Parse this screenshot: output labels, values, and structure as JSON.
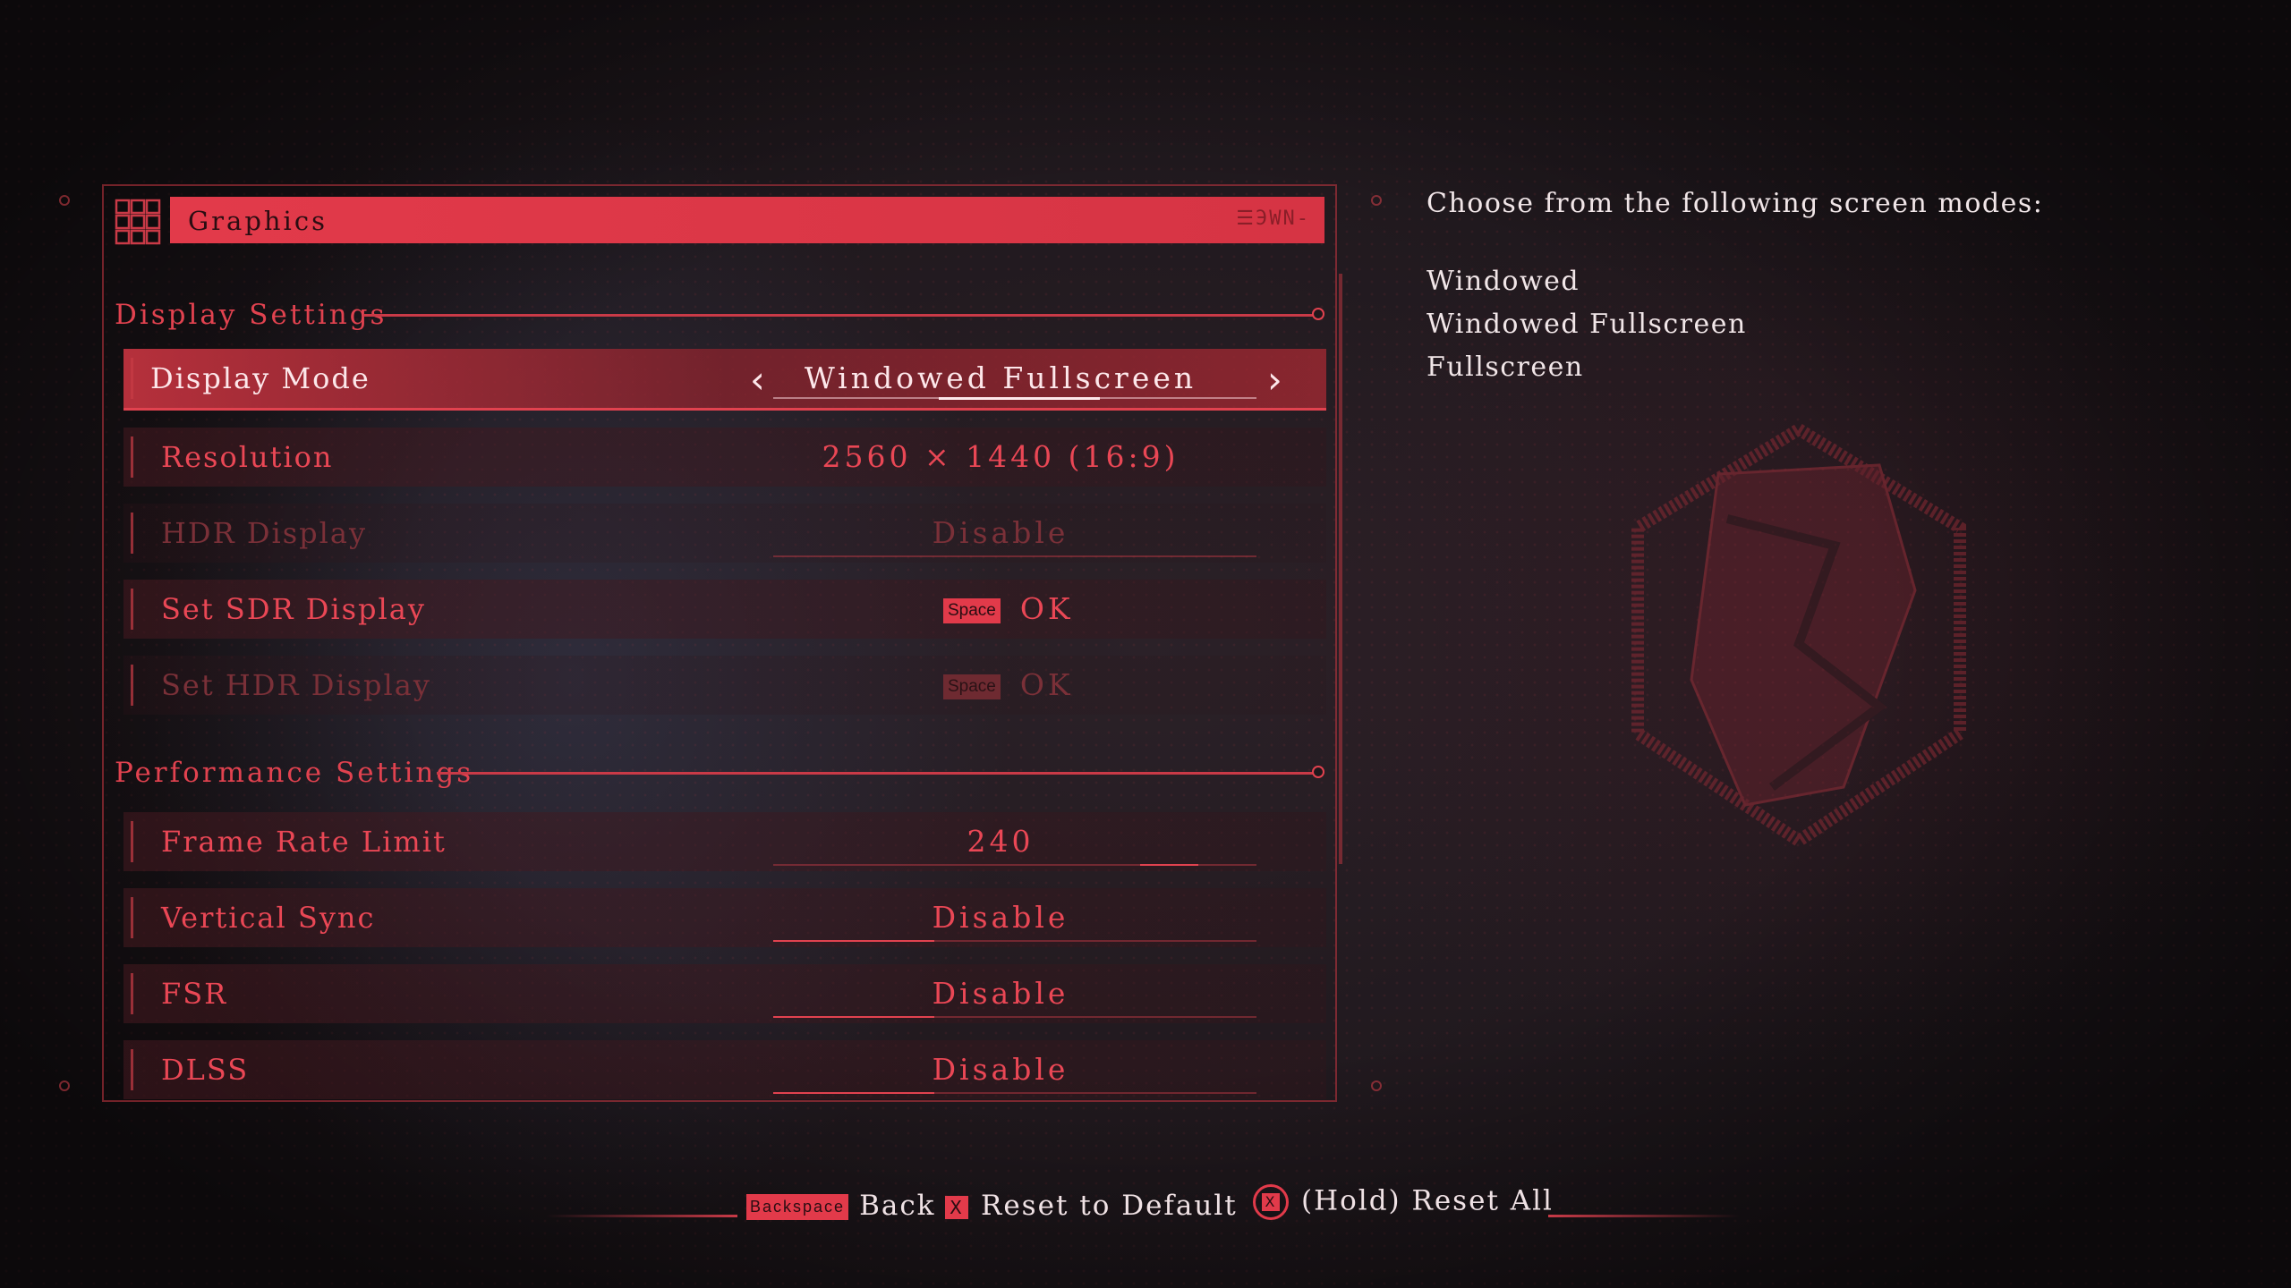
{
  "header": {
    "title": "Graphics",
    "logo_text": "☰ЭWN-"
  },
  "display_section": {
    "title": "Display Settings",
    "rows": [
      {
        "label": "Display Mode",
        "value": "Windowed Fullscreen",
        "state": "selected"
      },
      {
        "label": "Resolution",
        "value": "2560 × 1440 (16:9)",
        "state": "enabled"
      },
      {
        "label": "HDR Display",
        "value": "Disable",
        "state": "disabled"
      },
      {
        "label": "Set SDR Display",
        "key": "Space",
        "value": "OK",
        "state": "enabled"
      },
      {
        "label": "Set HDR Display",
        "key": "Space",
        "value": "OK",
        "state": "disabled"
      }
    ]
  },
  "performance_section": {
    "title": "Performance Settings",
    "rows": [
      {
        "label": "Frame Rate Limit",
        "value": "240",
        "slider_fraction": 0.88
      },
      {
        "label": "Vertical Sync",
        "value": "Disable"
      },
      {
        "label": "FSR",
        "value": "Disable"
      },
      {
        "label": "DLSS",
        "value": "Disable"
      }
    ]
  },
  "info": {
    "heading": "Choose from the following screen modes:",
    "options": [
      "Windowed",
      "Windowed Fullscreen",
      "Fullscreen"
    ]
  },
  "bottom_bar": {
    "back_key": "Backspace",
    "back_label": "Back",
    "reset_key": "X",
    "reset_label": "Reset to Default",
    "reset_all_key": "X",
    "reset_all_label": "(Hold) Reset All"
  },
  "colors": {
    "accent": "#e23a4a",
    "text_light": "#f1e6e8",
    "text_red": "#ea4755",
    "text_disabled": "#7a3038",
    "background": "#1d171b"
  },
  "icons": [
    "grid-icon",
    "chevron-left-icon",
    "chevron-right-icon",
    "x-button-icon",
    "x-circle-button-icon",
    "emblem-icon"
  ]
}
